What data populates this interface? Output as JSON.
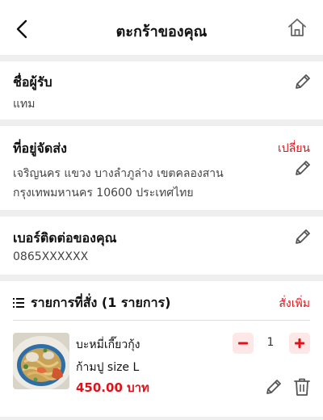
{
  "header": {
    "title": "ตะกร้าของคุณ",
    "back_icon": "chevron-left-icon",
    "home_icon": "home-icon"
  },
  "recipient": {
    "label": "ชื่อผู้รับ",
    "value": "แทม",
    "edit_icon": "pencil-icon"
  },
  "address": {
    "label": "ที่อยู่จัดส่ง",
    "change_label": "เปลี่ยน",
    "line1": "เจริญนคร แขวง บางลำภูล่าง เขตคลองสาน",
    "line2": "กรุงเทพมหานคร 10600 ประเทศไทย",
    "edit_icon": "pencil-icon"
  },
  "phone": {
    "label": "เบอร์ติดต่อของคุณ",
    "value": "0865XXXXXX",
    "edit_icon": "pencil-icon"
  },
  "order": {
    "list_icon": "list-icon",
    "title": "รายการที่สั่ง (1 รายการ)",
    "add_more_label": "สั่งเพิ่ม",
    "items": [
      {
        "name": "บะหมี่เกี๊ยวกุ้ง",
        "variant": "ก้ามปู size L",
        "price": "450.00 บาท",
        "quantity": "1",
        "image_icon": "food-photo"
      }
    ]
  },
  "colors": {
    "accent": "#e0131b",
    "background": "#efefef",
    "card": "#ffffff",
    "qty_button_bg": "#fde7e7"
  }
}
